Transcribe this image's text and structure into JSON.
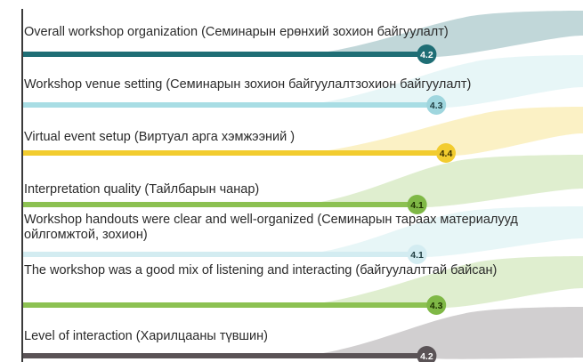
{
  "chart_data": {
    "type": "bar",
    "orientation": "horizontal",
    "xlim": [
      0,
      5
    ],
    "colors": {
      "axis": "#3a3a3a"
    },
    "categories": [
      "Overall workshop organization (Семинарын ерөнхий зохион байгуулалт)",
      "Workshop venue setting (Семинарын зохион байгуулалтзохион байгуулалт)",
      "Virtual event setup (Виртуал арга хэмжээний )",
      "Interpretation quality (Тайлбарын чанар)",
      "Workshop handouts were clear and well-organized (Семинарын тараах материалууд ойлгомжтой, зохион)",
      "The workshop was a good mix of listening and interacting (байгуулалттай байсан)",
      "Level of interaction (Харилцааны түвшин)"
    ],
    "values": [
      4.2,
      4.3,
      4.4,
      4.1,
      4.1,
      4.3,
      4.2
    ],
    "value_labels": [
      "4.2",
      "4.3",
      "4.4",
      "4.1",
      "4.1",
      "4.3",
      "4.2"
    ],
    "bar_colors": [
      "#1f6e75",
      "#a8dde4",
      "#f2cc2f",
      "#8cc152",
      "#d3ecf1",
      "#8cc152",
      "#5a5356"
    ],
    "ribbon_colors": [
      "#1f6e75",
      "#a8dde4",
      "#f2cc2f",
      "#8cc152",
      "#a8dde4",
      "#8cc152",
      "#5a5356"
    ],
    "badge_colors": [
      "#1f6e75",
      "#9fd6de",
      "#f2cc2f",
      "#7fb846",
      "#d3ecf1",
      "#7fb846",
      "#5a5356"
    ],
    "badge_text_colors": [
      "#ffffff",
      "#1f3d40",
      "#3a3000",
      "#1f3300",
      "#1f3d40",
      "#1f3300",
      "#ffffff"
    ]
  }
}
